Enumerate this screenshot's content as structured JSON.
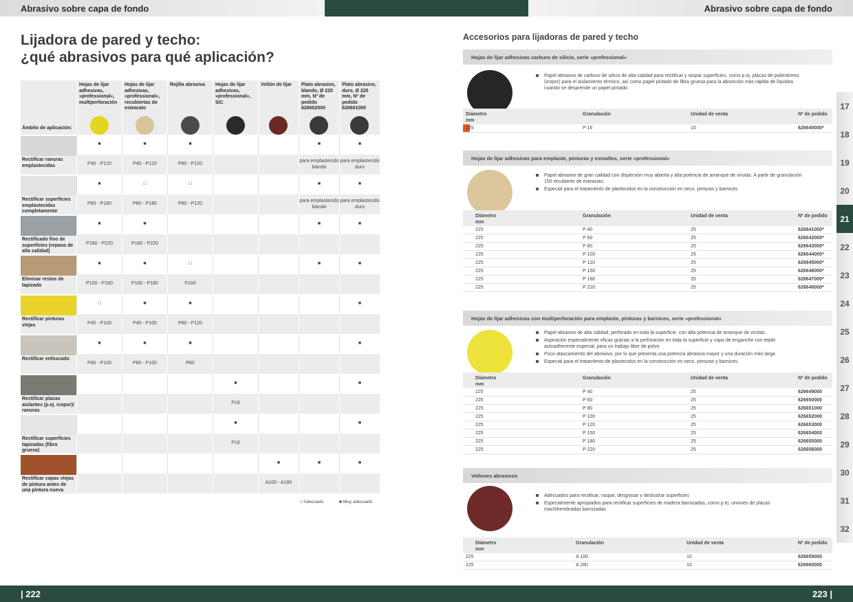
{
  "header": {
    "left": "Abrasivo sobre capa de fondo",
    "right": "Abrasivo sobre capa de fondo"
  },
  "footer": {
    "left_page": "| 222",
    "right_page": "223 |"
  },
  "title": {
    "line1": "Lijadora de pared y techo:",
    "line2": "¿qué abrasivos para qué aplicación?"
  },
  "matrix": {
    "ambito_label": "Ámbito de aplicación:",
    "columns": [
      {
        "label": "Hojas de lijar adhesivas, »professional«, multiperforación",
        "color": "#e6d51e"
      },
      {
        "label": "Hojas de lijar adhesivas, »professional«, recubiertas de estearato",
        "color": "#d9c59a"
      },
      {
        "label": "Rejilla abrasiva",
        "color": "#4a4a4a"
      },
      {
        "label": "Hojas de lijar adhesivas, »professional«, SIC",
        "color": "#2a2a2a"
      },
      {
        "label": "Vellón de lijar",
        "color": "#6b2a26"
      },
      {
        "label": "Plato abrasivo, blando, Ø 225 mm, Nº de pedido 626662000",
        "color": "#3a3a3a"
      },
      {
        "label": "Plato abrasivo, duro, Ø 225 mm, Nº de pedido 626661000",
        "color": "#3a3a3a"
      }
    ],
    "rows": [
      {
        "label": "Rectificar ranuras emplastecidas",
        "marks": [
          "■",
          "■",
          "■",
          "",
          "",
          "■",
          "■"
        ],
        "grits": [
          "P40 - P120",
          "P40 - P120",
          "P80 - P120",
          "",
          "",
          "para emplastecido blando",
          "para emplastecido duro"
        ],
        "photo": "#d8d8d8"
      },
      {
        "label": "Rectificar superficies emplastecidas completamente",
        "marks": [
          "■",
          "□",
          "□",
          "",
          "",
          "■",
          "■"
        ],
        "grits": [
          "P80 - P180",
          "P80 - P180",
          "P80 - P120",
          "",
          "",
          "para emplastecido blando",
          "para emplastecido duro"
        ],
        "photo": "#e4e4e4"
      },
      {
        "label": "Rectificado fino de superficies (repaso de alta calidad)",
        "marks": [
          "■",
          "■",
          "",
          "",
          "",
          "■",
          "■"
        ],
        "grits": [
          "P180 - P220",
          "P180 - P220",
          "",
          "",
          "",
          "",
          ""
        ],
        "photo": "#9aa0a4"
      },
      {
        "label": "Eliminar restos de tapizado",
        "marks": [
          "■",
          "■",
          "□",
          "",
          "",
          "■",
          "■"
        ],
        "grits": [
          "P100 - P180",
          "P100 - P180",
          "P100",
          "",
          "",
          "",
          ""
        ],
        "photo": "#b79a78"
      },
      {
        "label": "Rectificar pinturas viejas",
        "marks": [
          "□",
          "■",
          "■",
          "",
          "",
          "",
          "■"
        ],
        "grits": [
          "P40 - P100",
          "P40 - P100",
          "P80 - P120",
          "",
          "",
          "",
          ""
        ],
        "photo": "#e8d42a"
      },
      {
        "label": "Rectificar enfoscado",
        "marks": [
          "■",
          "■",
          "■",
          "",
          "",
          "",
          "■"
        ],
        "grits": [
          "P80 - P100",
          "P80 - P100",
          "P80",
          "",
          "",
          "",
          ""
        ],
        "photo": "#c9c4bc"
      },
      {
        "label": "Rectificar placas aislantes (p.ej. icopor)/ ranuras",
        "marks": [
          "",
          "",
          "",
          "■",
          "",
          "",
          "■"
        ],
        "grits": [
          "",
          "",
          "",
          "P16",
          "",
          "",
          ""
        ],
        "photo": "#7a7a72"
      },
      {
        "label": "Rectificar superficies tapizadas (fibra gruesa)",
        "marks": [
          "",
          "",
          "",
          "■",
          "",
          "",
          "■"
        ],
        "grits": [
          "",
          "",
          "",
          "P16",
          "",
          "",
          ""
        ],
        "photo": "#e6e6e6"
      },
      {
        "label": "Rectificar capas viejas de pintura antes de una pintura nueva",
        "marks": [
          "",
          "",
          "",
          "",
          "■",
          "■",
          "■"
        ],
        "grits": [
          "",
          "",
          "",
          "",
          "A100 - A180",
          "",
          ""
        ],
        "photo": "#a0522d"
      }
    ],
    "legend": {
      "suitable": "□ Adecuado",
      "very_suitable": "■ Muy adecuado"
    }
  },
  "right": {
    "title": "Accesorios para lijadoras de pared y techo",
    "headers": {
      "diam": "Diámetro mm",
      "gran": "Granulación",
      "unit": "Unidad de venta",
      "order": "Nº de pedido"
    },
    "sections": [
      {
        "title": "Hojas de lijar adhesivas carburo de silicio, serie »professional«",
        "color": "#262626",
        "bullets": [
          "Papel abrasivo de carburo de silicio de alta calidad para rectificar y raspar superficies, como p.ej. placas de poliestireno (icopor) para el aislamiento térmico, así como papel pintado de fibra gruesa para la absorción más rápida de líquidos cuando se desprende un papel pintado."
        ],
        "rows": [
          [
            "225",
            "P 16",
            "10",
            "626640000*"
          ]
        ]
      },
      {
        "title": "Hojas de lijar adhesivas para emplaste, pinturas y esmaltes, serie »professional«",
        "color": "#dcc79c",
        "bullets": [
          "Papel abrasivo de gran calidad con dispersión muy abierta y alta potencia de arranque de virutas. A partir de granulación 150 recubierto de estearato.",
          "Especial para el tratamiento de plastecidos en la construcción en seco, pinturas y barnices."
        ],
        "rows": [
          [
            "225",
            "P 40",
            "25",
            "626641000*"
          ],
          [
            "225",
            "P 60",
            "25",
            "626642000*"
          ],
          [
            "225",
            "P 80",
            "25",
            "626643000*"
          ],
          [
            "225",
            "P 100",
            "25",
            "626644000*"
          ],
          [
            "225",
            "P 120",
            "25",
            "626645000*"
          ],
          [
            "225",
            "P 150",
            "25",
            "626646000*"
          ],
          [
            "225",
            "P 180",
            "25",
            "626647000*"
          ],
          [
            "225",
            "P 220",
            "25",
            "626648000*"
          ]
        ]
      },
      {
        "title": "Hojas de lijar adhesivas con multiperforación para emplaste, pinturas y barnices, serie »professional«",
        "color": "#ede23a",
        "bullets": [
          "Papel abrasivo de alta calidad, perforado en toda la superficie, con alta potencia de arranque de virutas.",
          "Aspiración especialmente eficaz gracias a la perforación en toda la superficie y capa de enganche con tejido autoadherente especial, para un trabajo libre de polvo",
          "Poco atascamiento del abrasivo, por lo que presenta una potencia abrasiva mayor y una duración más larga",
          "Especial para el tratamiento de plastecidos en la construcción en seco, pinturas y barnices."
        ],
        "rows": [
          [
            "225",
            "P 40",
            "25",
            "626649000"
          ],
          [
            "225",
            "P 60",
            "25",
            "626650000"
          ],
          [
            "225",
            "P 80",
            "25",
            "626651000"
          ],
          [
            "225",
            "P 100",
            "25",
            "626652000"
          ],
          [
            "225",
            "P 120",
            "25",
            "626653000"
          ],
          [
            "225",
            "P 150",
            "25",
            "626654000"
          ],
          [
            "225",
            "P 180",
            "25",
            "626655000"
          ],
          [
            "225",
            "P 220",
            "25",
            "626656000"
          ]
        ]
      },
      {
        "title": "Vellones abrasivos",
        "color": "#6e2b2a",
        "bullets": [
          "Adecuados para rectificar, raspar, desgrasar y deslustrar superficies",
          "Especialmente apropiados para rectificar superficies de madera barnizadas, como p.ej. uniones de placas machihembradas barnizadas"
        ],
        "rows": [
          [
            "225",
            "A 100",
            "10",
            "626659000"
          ],
          [
            "225",
            "A 280",
            "10",
            "626660000"
          ]
        ]
      }
    ]
  },
  "tabs": [
    "17",
    "18",
    "19",
    "20",
    "21",
    "22",
    "23",
    "24",
    "25",
    "26",
    "27",
    "28",
    "29",
    "30",
    "31",
    "32"
  ],
  "active_tab": "21"
}
